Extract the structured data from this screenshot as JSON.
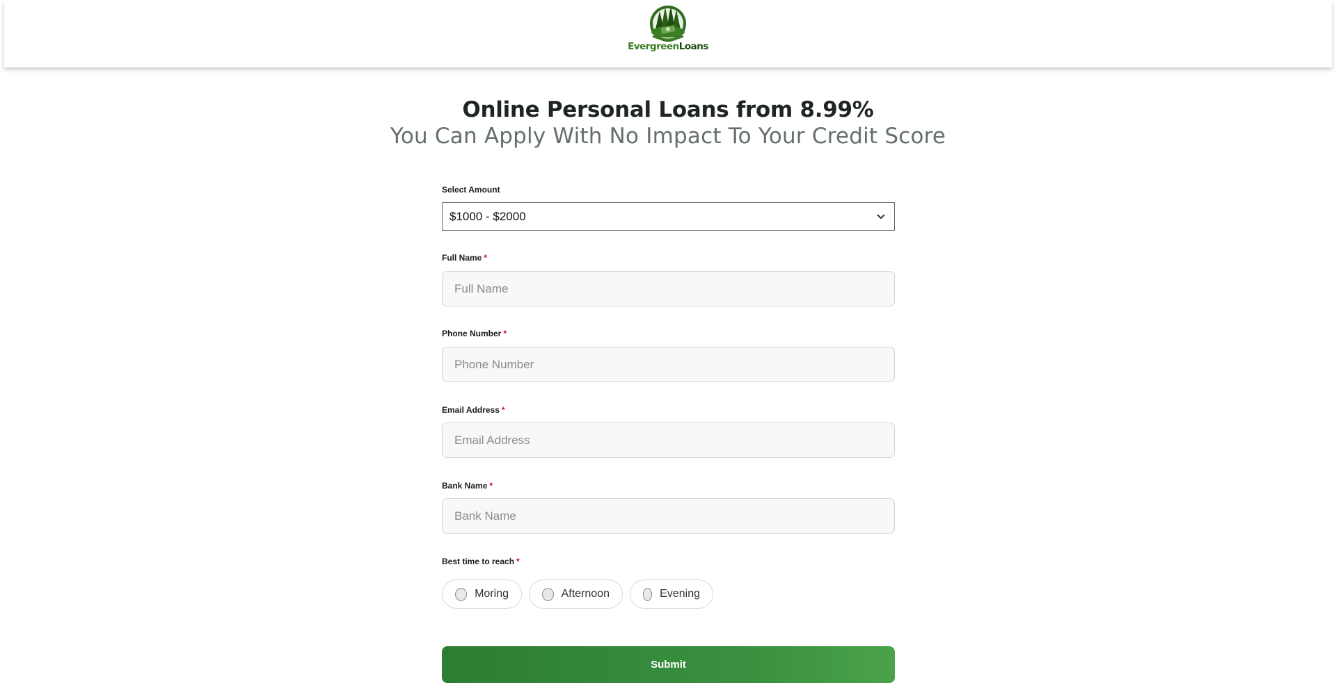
{
  "brand": {
    "name_part1": "Evergreen",
    "name_part2": "Loans",
    "primary_color": "#2e7d32",
    "dark_green": "#1f4e0f"
  },
  "hero": {
    "title": "Online Personal Loans from 8.99%",
    "subtitle": "You Can Apply With No Impact To Your Credit Score"
  },
  "form": {
    "amount": {
      "label": "Select Amount",
      "value": "$1000 - $2000"
    },
    "full_name": {
      "label": "Full Name",
      "required": "*",
      "placeholder": "Full Name"
    },
    "phone": {
      "label": "Phone Number",
      "required": "*",
      "placeholder": "Phone Number"
    },
    "email": {
      "label": "Email Address",
      "required": "*",
      "placeholder": "Email Address"
    },
    "bank": {
      "label": "Bank Name",
      "required": "*",
      "placeholder": "Bank Name"
    },
    "best_time": {
      "label": "Best time to reach",
      "required": "*",
      "options": [
        "Moring",
        "Afternoon",
        "Evening"
      ]
    },
    "submit_label": "Submit"
  }
}
